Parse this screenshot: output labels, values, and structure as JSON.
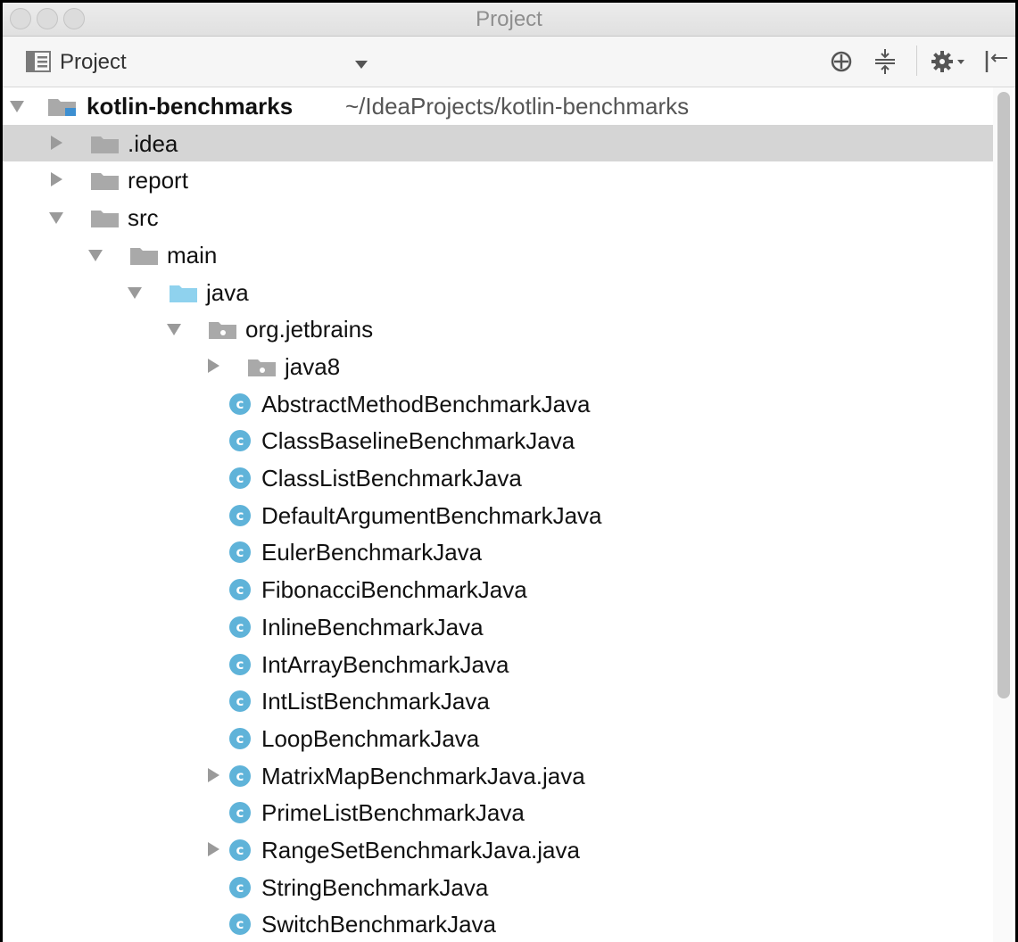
{
  "window": {
    "title": "Project"
  },
  "toolbar": {
    "view_label": "Project",
    "icons": [
      "project-view-icon",
      "dropdown-arrow-icon",
      "locate-icon",
      "collapse-all-icon",
      "settings-icon",
      "hide-panel-icon"
    ]
  },
  "tree": {
    "root": {
      "name": "kotlin-benchmarks",
      "path": "~/IdeaProjects/kotlin-benchmarks"
    },
    "items": [
      {
        "label": ".idea",
        "type": "folder",
        "depth": 1,
        "expander": "collapsed",
        "selected": true
      },
      {
        "label": "report",
        "type": "folder",
        "depth": 1,
        "expander": "collapsed"
      },
      {
        "label": "src",
        "type": "folder",
        "depth": 1,
        "expander": "expanded"
      },
      {
        "label": "main",
        "type": "folder",
        "depth": 2,
        "expander": "expanded"
      },
      {
        "label": "java",
        "type": "source-folder",
        "depth": 3,
        "expander": "expanded"
      },
      {
        "label": "org.jetbrains",
        "type": "package",
        "depth": 4,
        "expander": "expanded"
      },
      {
        "label": "java8",
        "type": "package",
        "depth": 5,
        "expander": "collapsed"
      },
      {
        "label": "AbstractMethodBenchmarkJava",
        "type": "class",
        "depth": 5,
        "expander": "none"
      },
      {
        "label": "ClassBaselineBenchmarkJava",
        "type": "class",
        "depth": 5,
        "expander": "none"
      },
      {
        "label": "ClassListBenchmarkJava",
        "type": "class",
        "depth": 5,
        "expander": "none"
      },
      {
        "label": "DefaultArgumentBenchmarkJava",
        "type": "class",
        "depth": 5,
        "expander": "none"
      },
      {
        "label": "EulerBenchmarkJava",
        "type": "class",
        "depth": 5,
        "expander": "none"
      },
      {
        "label": "FibonacciBenchmarkJava",
        "type": "class",
        "depth": 5,
        "expander": "none"
      },
      {
        "label": "InlineBenchmarkJava",
        "type": "class",
        "depth": 5,
        "expander": "none"
      },
      {
        "label": "IntArrayBenchmarkJava",
        "type": "class",
        "depth": 5,
        "expander": "none"
      },
      {
        "label": "IntListBenchmarkJava",
        "type": "class",
        "depth": 5,
        "expander": "none"
      },
      {
        "label": "LoopBenchmarkJava",
        "type": "class",
        "depth": 5,
        "expander": "none"
      },
      {
        "label": "MatrixMapBenchmarkJava.java",
        "type": "class",
        "depth": 5,
        "expander": "collapsed"
      },
      {
        "label": "PrimeListBenchmarkJava",
        "type": "class",
        "depth": 5,
        "expander": "none"
      },
      {
        "label": "RangeSetBenchmarkJava.java",
        "type": "class",
        "depth": 5,
        "expander": "collapsed"
      },
      {
        "label": "StringBenchmarkJava",
        "type": "class",
        "depth": 5,
        "expander": "none"
      },
      {
        "label": "SwitchBenchmarkJava",
        "type": "class",
        "depth": 5,
        "expander": "none"
      }
    ]
  },
  "icons": {
    "class_glyph": "c"
  },
  "colors": {
    "folder": "#a9a9a9",
    "source_folder": "#8fd2ee",
    "class_icon": "#5fb3d9",
    "selection": "#d5d5d5"
  }
}
